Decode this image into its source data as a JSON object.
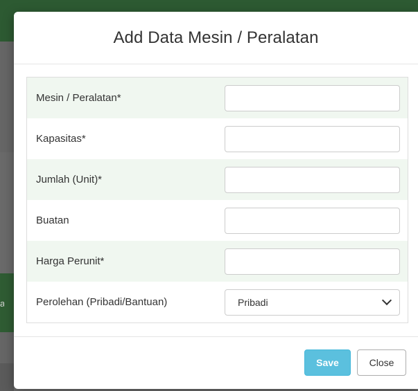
{
  "modal": {
    "title": "Add Data Mesin / Peralatan"
  },
  "form": {
    "fields": [
      {
        "label": "Mesin / Peralatan*",
        "value": "",
        "placeholder": ""
      },
      {
        "label": "Kapasitas*",
        "value": "",
        "placeholder": ""
      },
      {
        "label": "Jumlah (Unit)*",
        "value": "",
        "placeholder": ""
      },
      {
        "label": "Buatan",
        "value": "",
        "placeholder": ""
      },
      {
        "label": "Harga Perunit*",
        "value": "",
        "placeholder": ""
      }
    ],
    "select_field": {
      "label": "Perolehan (Pribadi/Bantuan)",
      "selected": "Pribadi"
    }
  },
  "footer": {
    "save_label": "Save",
    "close_label": "Close"
  },
  "background": {
    "edge_char": "a"
  },
  "colors": {
    "row_stripe": "#f0f7f0",
    "save_button": "#5bc0de",
    "backdrop_green": "#2d5a32"
  }
}
